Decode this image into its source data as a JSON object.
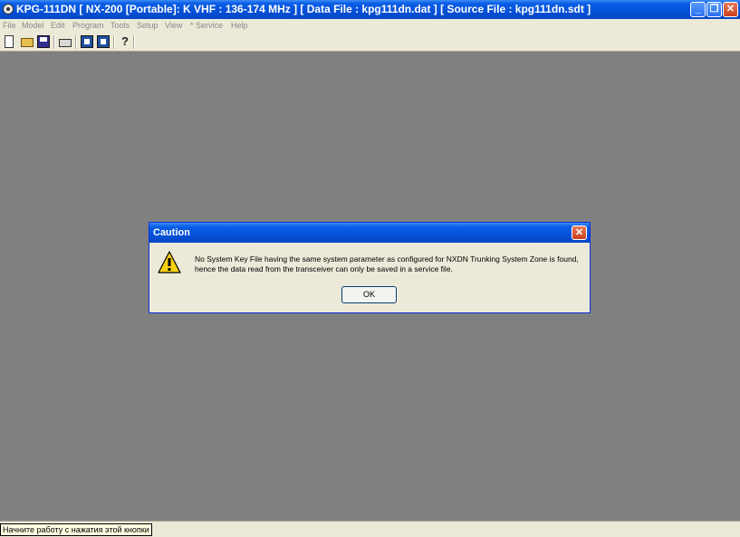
{
  "window": {
    "title": "KPG-111DN  [ NX-200  [Portable]: K VHF : 136-174 MHz ] [ Data File : kpg111dn.dat ] [ Source File : kpg111dn.sdt ]",
    "minimize": "_",
    "maximize": "❐",
    "close": "✕"
  },
  "menu": {
    "file": "File",
    "model": "Model",
    "edit": "Edit",
    "program": "Program",
    "tools": "Tools",
    "setup": "Setup",
    "view": "View",
    "service": "* Service",
    "help": "Help"
  },
  "toolbar": {
    "help_glyph": "?"
  },
  "dialog": {
    "title": "Caution",
    "close": "✕",
    "message_line1": "No System Key File having the same system parameter as configured for NXDN Trunking System Zone is found,",
    "message_line2": "hence the data read from the transceiver can only be saved in a service file.",
    "ok_label": "OK"
  },
  "tooltip": {
    "text": "Начните работу с нажатия этой кнопки"
  }
}
